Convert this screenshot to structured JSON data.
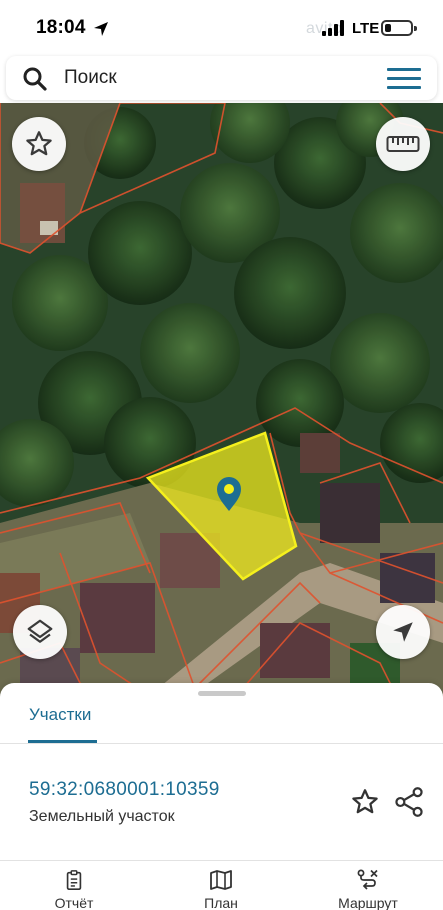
{
  "status_bar": {
    "time": "18:04",
    "network": "LTE",
    "watermark": "avito"
  },
  "search": {
    "placeholder": "Поиск"
  },
  "map": {
    "selected_parcel_color": "#f5f01d",
    "parcel_border_color": "#e0522e",
    "marker_color": "#1d6d92"
  },
  "sheet": {
    "tab_label": "Участки",
    "cadastral_number": "59:32:0680001:10359",
    "parcel_type": "Земельный участок"
  },
  "bottom_nav": {
    "items": [
      {
        "label": "Отчёт",
        "icon": "report-icon"
      },
      {
        "label": "План",
        "icon": "map-plan-icon"
      },
      {
        "label": "Маршрут",
        "icon": "route-icon"
      }
    ]
  },
  "colors": {
    "accent": "#1d6d92"
  }
}
